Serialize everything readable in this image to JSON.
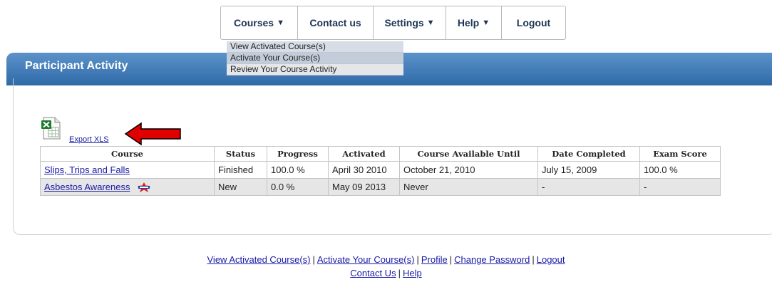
{
  "nav": {
    "courses": "Courses",
    "contact": "Contact us",
    "settings": "Settings",
    "help": "Help",
    "logout": "Logout",
    "caret": "▼"
  },
  "dropdown": {
    "items": [
      "View Activated Course(s)",
      "Activate Your Course(s)",
      "Review Your Course Activity"
    ]
  },
  "page": {
    "title": "Participant Activity"
  },
  "export": {
    "label": "Export XLS",
    "icon": "excel-file-icon"
  },
  "table": {
    "headers": [
      "Course",
      "Status",
      "Progress",
      "Activated",
      "Course Available Until",
      "Date Completed",
      "Exam Score"
    ],
    "rows": [
      {
        "course": "Slips, Trips and Falls",
        "status": "Finished",
        "progress": "100.0 %",
        "activated": "April 30 2010",
        "until": "October 21, 2010",
        "completed": "July 15, 2009",
        "score": "100.0 %"
      },
      {
        "course": "Asbestos Awareness",
        "badge": "new-badge-icon",
        "status": "New",
        "progress": "0.0 %",
        "activated": "May 09 2013",
        "until": "Never",
        "completed": "-",
        "score": "-"
      }
    ]
  },
  "footer": {
    "row1": [
      "View Activated Course(s)",
      "Activate Your Course(s)",
      "Profile",
      "Change Password",
      "Logout"
    ],
    "row2": [
      "Contact Us",
      "Help"
    ],
    "separator": "|"
  },
  "colors": {
    "header_bar": "#3d78b6",
    "link": "#1a1aa6",
    "nav_text": "#1c3555",
    "arrow": "#e00000"
  }
}
